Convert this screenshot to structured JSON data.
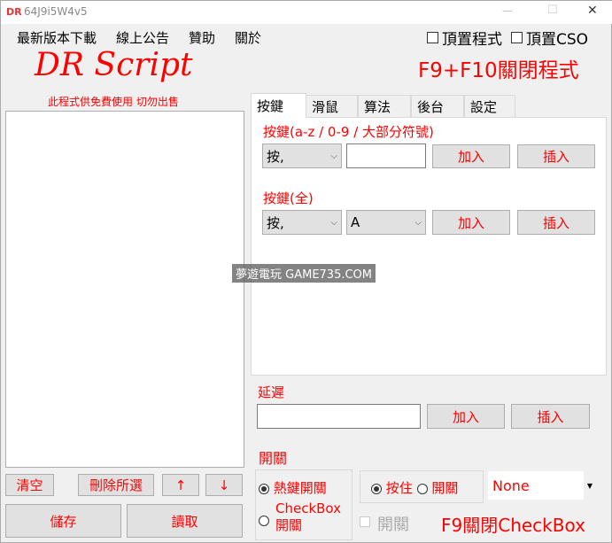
{
  "window": {
    "icon_text": "DR",
    "title": "64J9i5W4v5",
    "minimize": "—",
    "maximize": "☐",
    "close": "✕"
  },
  "menu": [
    "最新版本下載",
    "線上公告",
    "贊助",
    "關於"
  ],
  "top_options": {
    "topmost_program": "頂置程式",
    "topmost_cso": "頂置CSO"
  },
  "logo": "DR Script",
  "hotkey_notice": "F9+F10關閉程式",
  "free_notice": "此程式供免費使用 切勿出售",
  "tabs": [
    "按鍵",
    "滑鼠",
    "算法",
    "後台",
    "設定"
  ],
  "key_section": {
    "label1": "按鍵(a-z / 0-9 / 大部分符號)",
    "combo1": "按,",
    "input1": "",
    "add": "加入",
    "insert": "插入",
    "label2": "按鍵(全)",
    "combo2": "按,",
    "combo3": "A"
  },
  "watermark": "夢遊電玩 GAME735.COM",
  "delay": {
    "label": "延遲",
    "value": "",
    "add": "加入",
    "insert": "插入"
  },
  "list_buttons": {
    "clear": "清空",
    "delete_selected": "刪除所選",
    "up": "↑",
    "down": "↓",
    "save": "儲存",
    "load": "讀取"
  },
  "toggle": {
    "label": "開關",
    "hotkey_toggle": "熱鍵開關",
    "checkbox_toggle_1": "CheckBox",
    "checkbox_toggle_2": "開關",
    "hold": "按住",
    "switch": "開關",
    "key_select": "None",
    "checkbox_label": "開關",
    "f9_notice": "F9關閉CheckBox"
  }
}
